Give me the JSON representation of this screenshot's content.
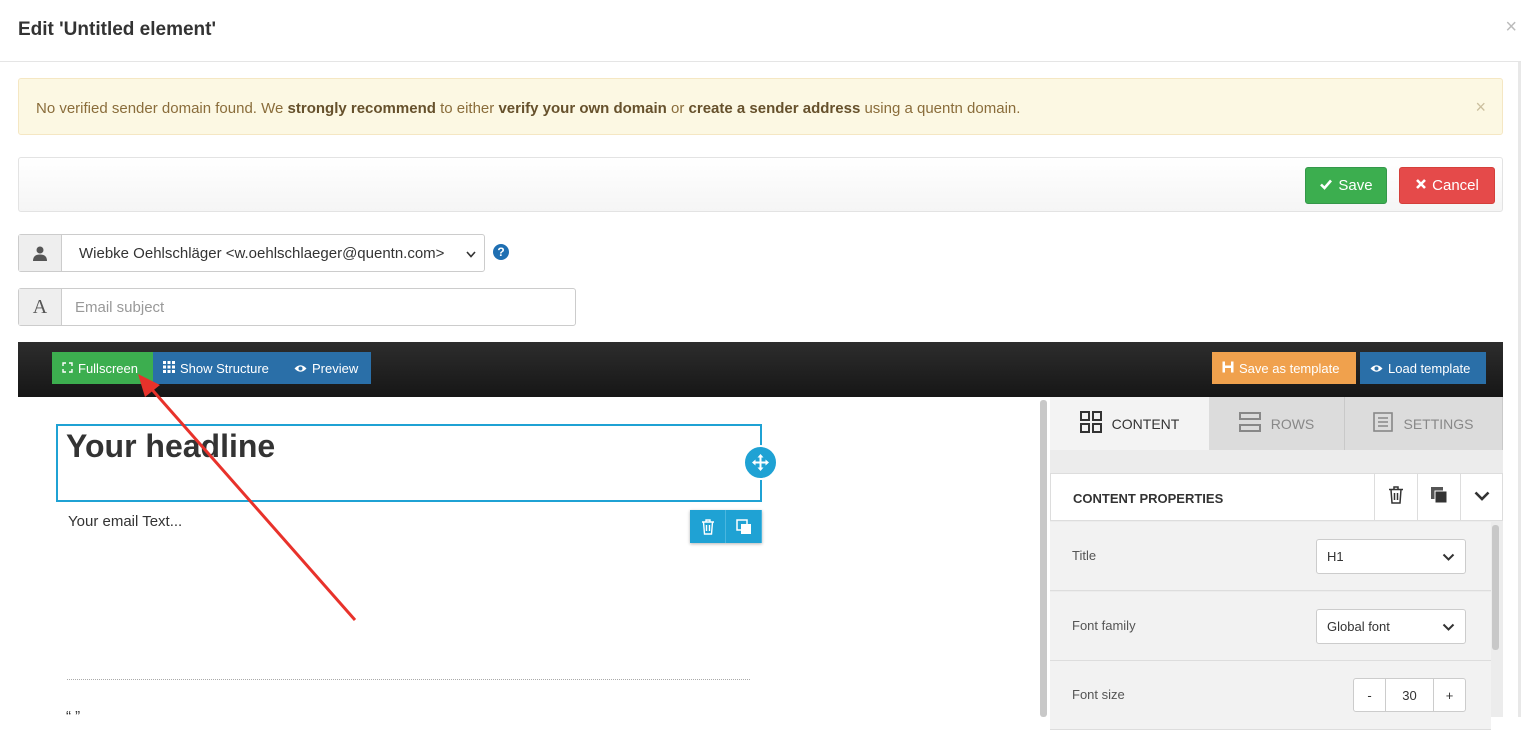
{
  "modal": {
    "title": "Edit 'Untitled element'",
    "close": "×"
  },
  "alert": {
    "part1": "No verified sender domain found. We ",
    "strong1": "strongly recommend",
    "part2": " to either ",
    "strong2": "verify your own domain",
    "part3": " or ",
    "strong3": "create a sender address",
    "part4": " using a quentn domain.",
    "close": "×"
  },
  "toolbar": {
    "save_label": "Save",
    "cancel_label": "Cancel"
  },
  "sender": {
    "value": "Wiebke Oehlschläger <w.oehlschlaeger@quentn.com>",
    "help": "?"
  },
  "subject": {
    "placeholder": "Email subject",
    "addon": "A"
  },
  "editor_bar": {
    "fullscreen": "Fullscreen",
    "show_structure": "Show Structure",
    "preview": "Preview",
    "save_template": "Save as template",
    "load_template": "Load template"
  },
  "canvas": {
    "headline": "Your headline",
    "email_text": "Your email Text...",
    "footer_text": "“ ”"
  },
  "side_panel": {
    "tabs": [
      {
        "label": "CONTENT",
        "icon": "grid-icon"
      },
      {
        "label": "ROWS",
        "icon": "rows-icon"
      },
      {
        "label": "SETTINGS",
        "icon": "settings-icon"
      }
    ],
    "props_title": "CONTENT PROPERTIES",
    "properties": {
      "title_label": "Title",
      "title_value": "H1",
      "font_family_label": "Font family",
      "font_family_value": "Global font",
      "font_size_label": "Font size",
      "font_size_value": "30",
      "minus": "-",
      "plus": "+"
    }
  },
  "colors": {
    "accent": "#1fa2d4",
    "save": "#3cae4f",
    "cancel": "#e54a4a",
    "orange": "#f0a14d",
    "blue": "#2a6fa8",
    "arrow": "#e8322b"
  }
}
